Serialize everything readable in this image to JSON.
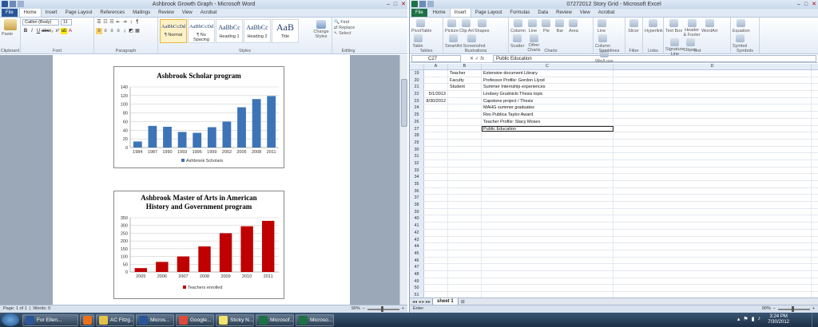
{
  "word": {
    "title": "Ashbrook Growth Graph - Microsoft Word",
    "tabs": [
      "File",
      "Home",
      "Insert",
      "Page Layout",
      "References",
      "Mailings",
      "Review",
      "View",
      "Acrobat"
    ],
    "active_tab": "Home",
    "clipboard": {
      "paste": "Paste",
      "label": "Clipboard"
    },
    "font": {
      "name": "Calibri (Body)",
      "size": "11",
      "label": "Font"
    },
    "paragraph_label": "Paragraph",
    "styles": [
      {
        "sample": "AaBbCcDd",
        "name": "¶ Normal"
      },
      {
        "sample": "AaBbCcDd",
        "name": "¶ No Spacing"
      },
      {
        "sample": "AaBbCc",
        "name": "Heading 1"
      },
      {
        "sample": "AaBbCc",
        "name": "Heading 2"
      },
      {
        "sample": "AaB",
        "name": "Title"
      }
    ],
    "change_styles": "Change Styles",
    "styles_label": "Styles",
    "editing": {
      "find": "Find",
      "replace": "Replace",
      "select": "Select",
      "label": "Editing"
    },
    "status": {
      "page": "Page: 1 of 1",
      "words": "Words: 0",
      "zoom": "90%"
    }
  },
  "chart_data": [
    {
      "type": "bar",
      "title": "Ashbrook Scholar program",
      "categories": [
        "1984",
        "1987",
        "1990",
        "1993",
        "1996",
        "1999",
        "2002",
        "2005",
        "2008",
        "2011"
      ],
      "series": [
        {
          "name": "Ashbrook Scholars",
          "values": [
            14,
            50,
            48,
            36,
            34,
            47,
            60,
            93,
            112,
            119
          ]
        }
      ],
      "ylim": [
        0,
        140
      ],
      "yticks": [
        "0",
        "20",
        "40",
        "60",
        "80",
        "100",
        "120",
        "140"
      ],
      "color": "#3d74b8",
      "legend": "bottom"
    },
    {
      "type": "bar",
      "title": "Ashbrook Master of Arts in American History and Government program",
      "title_lines": [
        "Ashbrook Master of Arts in American",
        "History and Government program"
      ],
      "categories": [
        "2005",
        "2006",
        "2007",
        "2008",
        "2009",
        "2010",
        "2011"
      ],
      "series": [
        {
          "name": "Teachers enrolled",
          "values": [
            25,
            65,
            100,
            165,
            250,
            295,
            330
          ]
        }
      ],
      "ylim": [
        0,
        350
      ],
      "yticks": [
        "0",
        "50",
        "100",
        "150",
        "200",
        "250",
        "300",
        "350"
      ],
      "color": "#c00000",
      "legend": "bottom"
    }
  ],
  "excel": {
    "title": "07272012 Story Grid - Microsoft Excel",
    "tabs": [
      "File",
      "Home",
      "Insert",
      "Page Layout",
      "Formulas",
      "Data",
      "Review",
      "View",
      "Acrobat"
    ],
    "active_tab": "Insert",
    "ribbon_groups": [
      {
        "label": "Tables",
        "items": [
          "PivotTable",
          "Table"
        ]
      },
      {
        "label": "Illustrations",
        "items": [
          "Picture",
          "Clip Art",
          "Shapes",
          "SmartArt",
          "Screenshot"
        ]
      },
      {
        "label": "Charts",
        "items": [
          "Column",
          "Line",
          "Pie",
          "Bar",
          "Area",
          "Scatter",
          "Other Charts"
        ]
      },
      {
        "label": "Sparklines",
        "items": [
          "Line",
          "Column",
          "Win/Loss"
        ]
      },
      {
        "label": "Filter",
        "items": [
          "Slicer"
        ]
      },
      {
        "label": "Links",
        "items": [
          "Hyperlink"
        ]
      },
      {
        "label": "Text",
        "items": [
          "Text Box",
          "Header & Footer",
          "WordArt",
          "Signature Line",
          "Object"
        ]
      },
      {
        "label": "Symbols",
        "items": [
          "Equation",
          "Symbol"
        ]
      }
    ],
    "name_box": "C27",
    "formula": "Public Education",
    "columns": [
      "A",
      "B",
      "C",
      "D"
    ],
    "rows": [
      {
        "n": "19",
        "a": "",
        "b": "Teacher",
        "c": "Extensive document Library"
      },
      {
        "n": "20",
        "a": "",
        "b": "Faculty",
        "c": "Professor Profile: Gordon Llyod"
      },
      {
        "n": "21",
        "a": "",
        "b": "Student",
        "c": "Summer Internship experiences"
      },
      {
        "n": "22",
        "a": "5/1/2013",
        "b": "",
        "c": "Lindsey Grudnicki Thesis topic"
      },
      {
        "n": "23",
        "a": "8/30/2012",
        "b": "",
        "c": "Capstone project / Thesis"
      },
      {
        "n": "24",
        "a": "",
        "b": "",
        "c": "MAHG summer graduates"
      },
      {
        "n": "25",
        "a": "",
        "b": "",
        "c": "Res Publica Taylor Award"
      },
      {
        "n": "26",
        "a": "",
        "b": "",
        "c": "Teacher Profile: Stacy Moses"
      },
      {
        "n": "27",
        "a": "",
        "b": "",
        "c": "Public Education"
      },
      {
        "n": "28",
        "a": "",
        "b": "",
        "c": ""
      },
      {
        "n": "29",
        "a": "",
        "b": "",
        "c": ""
      },
      {
        "n": "30",
        "a": "",
        "b": "",
        "c": ""
      },
      {
        "n": "31",
        "a": "",
        "b": "",
        "c": ""
      },
      {
        "n": "32",
        "a": "",
        "b": "",
        "c": ""
      },
      {
        "n": "33",
        "a": "",
        "b": "",
        "c": ""
      },
      {
        "n": "34",
        "a": "",
        "b": "",
        "c": ""
      },
      {
        "n": "35",
        "a": "",
        "b": "",
        "c": ""
      },
      {
        "n": "36",
        "a": "",
        "b": "",
        "c": ""
      },
      {
        "n": "37",
        "a": "",
        "b": "",
        "c": ""
      },
      {
        "n": "38",
        "a": "",
        "b": "",
        "c": ""
      },
      {
        "n": "39",
        "a": "",
        "b": "",
        "c": ""
      },
      {
        "n": "40",
        "a": "",
        "b": "",
        "c": ""
      },
      {
        "n": "41",
        "a": "",
        "b": "",
        "c": ""
      },
      {
        "n": "42",
        "a": "",
        "b": "",
        "c": ""
      },
      {
        "n": "43",
        "a": "",
        "b": "",
        "c": ""
      },
      {
        "n": "44",
        "a": "",
        "b": "",
        "c": ""
      },
      {
        "n": "45",
        "a": "",
        "b": "",
        "c": ""
      },
      {
        "n": "46",
        "a": "",
        "b": "",
        "c": ""
      },
      {
        "n": "47",
        "a": "",
        "b": "",
        "c": ""
      },
      {
        "n": "48",
        "a": "",
        "b": "",
        "c": ""
      },
      {
        "n": "49",
        "a": "",
        "b": "",
        "c": ""
      },
      {
        "n": "50",
        "a": "",
        "b": "",
        "c": ""
      },
      {
        "n": "51",
        "a": "",
        "b": "",
        "c": ""
      },
      {
        "n": "52",
        "a": "",
        "b": "",
        "c": ""
      }
    ],
    "sheet_tab": "sheet 1",
    "status": "Enter",
    "zoom": "90%"
  },
  "taskbar": {
    "items": [
      {
        "label": "For Ellen...",
        "color": "#2a5699",
        "icon": "ie-icon"
      },
      {
        "label": "",
        "color": "#e8711c",
        "icon": "media-player-icon"
      },
      {
        "label": "AC Fitzg...",
        "color": "#e6c14a",
        "icon": "folder-icon"
      },
      {
        "label": "Micros...",
        "color": "#2a5699",
        "icon": "word-icon"
      },
      {
        "label": "Google...",
        "color": "#dd4b39",
        "icon": "chrome-icon"
      },
      {
        "label": "Sticky N...",
        "color": "#f2e36b",
        "icon": "sticky-notes-icon"
      },
      {
        "label": "Microsof...",
        "color": "#1e7145",
        "icon": "excel-icon"
      },
      {
        "label": "Microso...",
        "color": "#1e7145",
        "icon": "excel-icon"
      }
    ],
    "time": "3:24 PM",
    "date": "7/30/2012"
  }
}
